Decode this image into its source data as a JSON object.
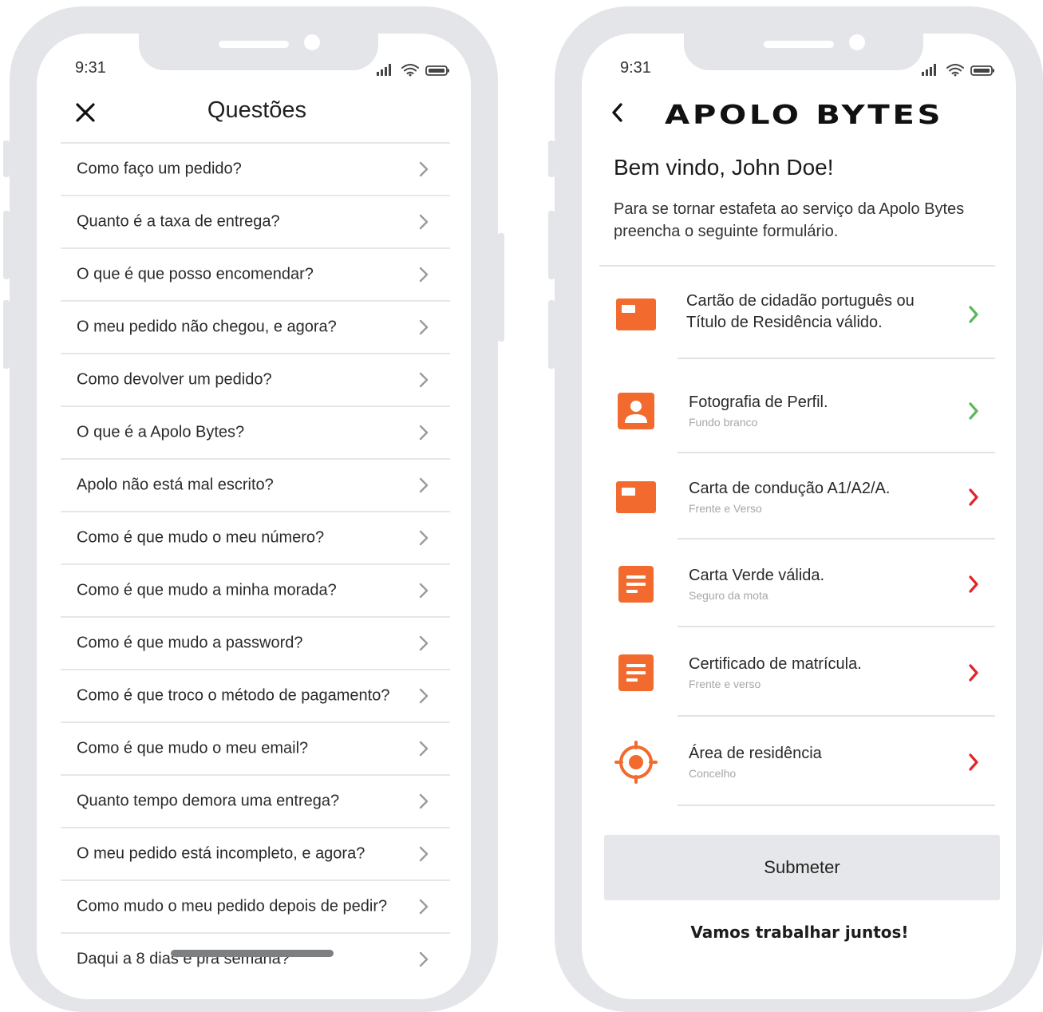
{
  "faq_screen": {
    "status_time": "9:31",
    "title": "Questões",
    "items": [
      {
        "label": "Como faço um pedido?"
      },
      {
        "label": "Quanto é a taxa de entrega?"
      },
      {
        "label": "O que é que posso encomendar?"
      },
      {
        "label": "O meu pedido não chegou, e agora?"
      },
      {
        "label": "Como devolver um pedido?"
      },
      {
        "label": "O que é a Apolo Bytes?"
      },
      {
        "label": "Apolo não está mal escrito?"
      },
      {
        "label": "Como é que mudo o meu número?"
      },
      {
        "label": "Como é que mudo a minha morada?"
      },
      {
        "label": "Como é que mudo a password?"
      },
      {
        "label": "Como é que troco o método de pagamento?"
      },
      {
        "label": "Como é que mudo o meu email?"
      },
      {
        "label": "Quanto tempo demora uma entrega?"
      },
      {
        "label": "O meu pedido está incompleto, e agora?"
      },
      {
        "label": "Como mudo o meu pedido depois de pedir?"
      },
      {
        "label": "Daqui a 8 dias é prá semana?"
      }
    ]
  },
  "courier_screen": {
    "status_time": "9:31",
    "brand": "APOLO BYTES",
    "welcome": "Bem vindo, John Doe!",
    "intro": "Para se tornar estafeta ao serviço da Apolo Bytes preencha o seguinte formulário.",
    "requirements": [
      {
        "icon": "id-card-icon",
        "title": "Cartão de cidadão português ou Título de Residência válido.",
        "subtitle": "",
        "status": "complete"
      },
      {
        "icon": "profile-photo-icon",
        "title": "Fotografia de Perfil.",
        "subtitle": "Fundo branco",
        "status": "complete"
      },
      {
        "icon": "driving-license-icon",
        "title": "Carta de condução A1/A2/A.",
        "subtitle": "Frente e Verso",
        "status": "pending"
      },
      {
        "icon": "document-icon",
        "title": "Carta Verde válida.",
        "subtitle": "Seguro da mota",
        "status": "pending"
      },
      {
        "icon": "document-icon",
        "title": "Certificado de matrícula.",
        "subtitle": "Frente e verso",
        "status": "pending"
      },
      {
        "icon": "location-target-icon",
        "title": "Área de residência",
        "subtitle": "Concelho",
        "status": "pending"
      }
    ],
    "submit_label": "Submeter",
    "tagline": "Vamos trabalhar juntos!"
  },
  "colors": {
    "accent_orange": "#f26a2e",
    "complete_green": "#5cb85c",
    "pending_red": "#e0252b",
    "frame_gray": "#e3e5e8"
  }
}
